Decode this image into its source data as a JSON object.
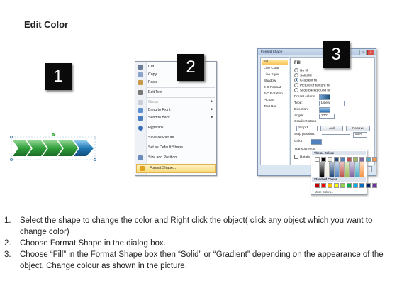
{
  "title": "Edit Color",
  "badges": [
    "1",
    "2",
    "3"
  ],
  "colors": {
    "badge_bg": "#0a0a0a",
    "arrow_green": "#2f9e3a",
    "arrow_blue": "#1f78b4",
    "highlight": "#fbd978"
  },
  "context_menu": {
    "items": [
      {
        "label": "Cut",
        "icon": "scissors-icon",
        "enabled": true,
        "submenu": false
      },
      {
        "label": "Copy",
        "icon": "copy-icon",
        "enabled": true,
        "submenu": false
      },
      {
        "label": "Paste",
        "icon": "paste-icon",
        "enabled": true,
        "submenu": false
      },
      {
        "label": "Edit Text",
        "icon": "edit-text-icon",
        "enabled": true,
        "submenu": false
      },
      {
        "label": "Group",
        "icon": "group-icon",
        "enabled": false,
        "submenu": true
      },
      {
        "label": "Bring to Front",
        "icon": "bring-front-icon",
        "enabled": true,
        "submenu": true
      },
      {
        "label": "Send to Back",
        "icon": "send-back-icon",
        "enabled": true,
        "submenu": true
      },
      {
        "label": "Hyperlink...",
        "icon": "hyperlink-icon",
        "enabled": true,
        "submenu": false
      },
      {
        "label": "Save as Picture...",
        "icon": "",
        "enabled": true,
        "submenu": false
      },
      {
        "label": "Set as Default Shape",
        "icon": "",
        "enabled": true,
        "submenu": false
      },
      {
        "label": "Size and Position...",
        "icon": "size-position-icon",
        "enabled": true,
        "submenu": false
      },
      {
        "label": "Format Shape...",
        "icon": "format-shape-icon",
        "enabled": true,
        "submenu": false,
        "highlighted": true
      }
    ]
  },
  "format_dialog": {
    "title": "Format Shape",
    "nav": [
      "Fill",
      "Line Color",
      "Line Style",
      "Shadow",
      "3-D Format",
      "3-D Rotation",
      "Picture",
      "Text Box"
    ],
    "fill_heading": "Fill",
    "options": [
      "No fill",
      "Solid fill",
      "Gradient fill",
      "Picture or texture fill",
      "Slide background fill"
    ],
    "selected_option": "Gradient fill",
    "preset_label": "Preset colors:",
    "type_label": "Type:",
    "type_value": "Linear",
    "direction_label": "Direction:",
    "angle_label": "Angle:",
    "angle_value": "270°",
    "stops_label": "Gradient stops",
    "stop_value": "Stop 1",
    "add_label": "Add",
    "remove_label": "Remove",
    "stop_position_label": "Stop position:",
    "stop_position_value": "50%",
    "color_label": "Color:",
    "transparency_label": "Transparency:",
    "rotate_label": "Rotate with shape",
    "close_label": "Close"
  },
  "palette": {
    "theme_heading": "Theme Colors",
    "standard_heading": "Standard Colors",
    "more_label": "More Colors...",
    "theme_top": [
      "#ffffff",
      "#000000",
      "#eeece1",
      "#1f497d",
      "#4f81bd",
      "#c0504d",
      "#9bbb59",
      "#8064a2",
      "#4bacc6",
      "#f79646"
    ],
    "standard": [
      "#c00000",
      "#ff0000",
      "#ffc000",
      "#ffff00",
      "#92d050",
      "#00b050",
      "#00b0f0",
      "#0070c0",
      "#002060",
      "#7030a0"
    ]
  },
  "steps": [
    {
      "num": "1.",
      "text": "Select the shape to change the color and Right click the object( click any object which you want to change color)"
    },
    {
      "num": "2.",
      "text": "Choose Format Shape in the dialog box."
    },
    {
      "num": "3.",
      "text": "Choose “Fill” in the Format Shape box then “Solid” or “Gradient” depending on the appearance of the object. Change colour as shown in the picture."
    }
  ]
}
